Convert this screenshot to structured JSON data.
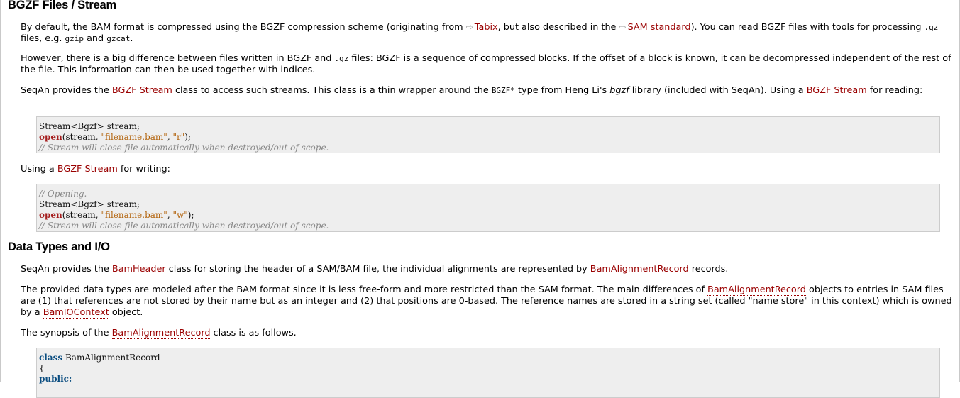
{
  "sections": {
    "bgzf": {
      "title": "BGZF Files / Stream",
      "p1": {
        "t1": "By default, the BAM format is compressed using the BGZF compression scheme (originating from ",
        "link1": "Tabix",
        "t2": ", but also described in the ",
        "link2": "SAM standard",
        "t3": "). You can read BGZF files with tools for processing ",
        "code1": ".gz",
        "t4": " files, e.g. ",
        "code2": "gzip",
        "t5": " and ",
        "code3": "gzcat",
        "t6": "."
      },
      "p2": {
        "t1": "However, there is a big difference between files written in BGZF and ",
        "code1": ".gz",
        "t2": " files: BGZF is a sequence of compressed blocks. If the offset of a block is known, it can be decompressed independent of the rest of the file. This information can then be used together with indices."
      },
      "p3": {
        "t1": "SeqAn provides the ",
        "link1": "BGZF Stream",
        "t2": " class to access such streams. This class is a thin wrapper around the ",
        "code1": "BGZF*",
        "t3": " type from Heng Li's ",
        "em1": "bgzf",
        "t4": " library (included with SeqAn). Using a ",
        "link2": "BGZF Stream",
        "t5": " for reading:"
      },
      "code_read": {
        "l1": "Stream<Bgzf> stream;",
        "l2_kw": "open",
        "l2_a": "(stream, ",
        "l2_s1": "\"filename.bam\"",
        "l2_b": ", ",
        "l2_s2": "\"r\"",
        "l2_c": ");",
        "l3": "// Stream will close file automatically when destroyed/out of scope."
      },
      "p4": {
        "t1": "Using a ",
        "link1": "BGZF Stream",
        "t2": " for writing:"
      },
      "code_write": {
        "l0": "// Opening.",
        "l1": "Stream<Bgzf> stream;",
        "l2_kw": "open",
        "l2_a": "(stream, ",
        "l2_s1": "\"filename.bam\"",
        "l2_b": ", ",
        "l2_s2": "\"w\"",
        "l2_c": ");",
        "l3": "// Stream will close file automatically when destroyed/out of scope."
      }
    },
    "datatypes": {
      "title": "Data Types and I/O",
      "p1": {
        "t1": "SeqAn provides the ",
        "link1": "BamHeader",
        "t2": " class for storing the header of a SAM/BAM file, the individual alignments are represented by ",
        "link2": "BamAlignmentRecord",
        "t3": " records."
      },
      "p2": {
        "t1": "The provided data types are modeled after the BAM format since it is less free-form and more restricted than the SAM format. The main differences of ",
        "link1": "BamAlignmentRecord",
        "t2": " objects to entries in SAM files are (1) that references are not stored by their name but as an integer and (2) that positions are 0-based. The reference names are stored in a string set (called \"name store\" in this context) which is owned by a ",
        "link2": "BamIOContext",
        "t3": " object."
      },
      "p3": {
        "t1": "The synopsis of the ",
        "link1": "BamAlignmentRecord",
        "t2": " class is as follows."
      },
      "code_synopsis": {
        "l1_kw": "class",
        "l1_a": " BamAlignmentRecord",
        "l2": "{",
        "l3_kw": "public:"
      }
    }
  }
}
